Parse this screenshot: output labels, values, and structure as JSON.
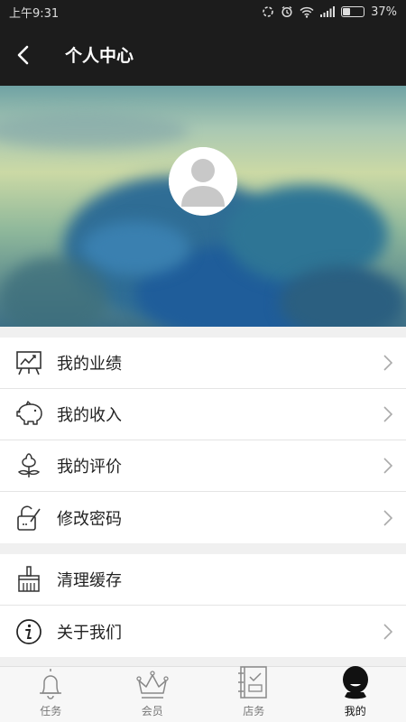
{
  "status_bar": {
    "time": "上午9:31",
    "battery": "37%",
    "battery_level": 0.37
  },
  "header": {
    "title": "个人中心",
    "back_icon": "chevron-left-icon"
  },
  "profile": {
    "avatar_icon": "default-avatar-icon"
  },
  "menu": {
    "group1": [
      {
        "label": "我的业绩",
        "icon": "performance-chart-icon"
      },
      {
        "label": "我的收入",
        "icon": "piggy-bank-icon"
      },
      {
        "label": "我的评价",
        "icon": "flower-icon"
      },
      {
        "label": "修改密码",
        "icon": "lock-icon"
      }
    ],
    "group2": [
      {
        "label": "清理缓存",
        "icon": "broom-icon"
      },
      {
        "label": "关于我们",
        "icon": "info-icon"
      }
    ]
  },
  "tab_bar": {
    "tabs": [
      {
        "label": "任务",
        "icon": "bell-icon"
      },
      {
        "label": "会员",
        "icon": "crown-icon"
      },
      {
        "label": "店务",
        "icon": "notebook-icon"
      },
      {
        "label": "我的",
        "icon": "user-icon"
      }
    ],
    "active": "我的"
  },
  "colors": {
    "header_bg": "#1c1c1c",
    "page_bg": "#f0f0f0",
    "active_tab": "#111111"
  }
}
